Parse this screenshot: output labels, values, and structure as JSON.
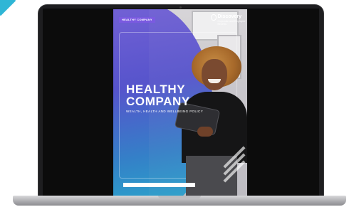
{
  "brochure": {
    "tag": "HEALTHY COMPANY",
    "brand_name": "Discovery",
    "brand_tagline": "Corporate and Employee Benefits",
    "title": "HEALTHY\nCOMPANY",
    "subtitle": "WEALTH, HEALTH AND WELLBEING POLICY"
  },
  "icons": {
    "brand_logo": "discovery-logo-icon"
  },
  "colors": {
    "accent_purple": "#7a5ae0",
    "accent_teal": "#2aa7c9",
    "corner_accent": "#2fb6d6"
  }
}
